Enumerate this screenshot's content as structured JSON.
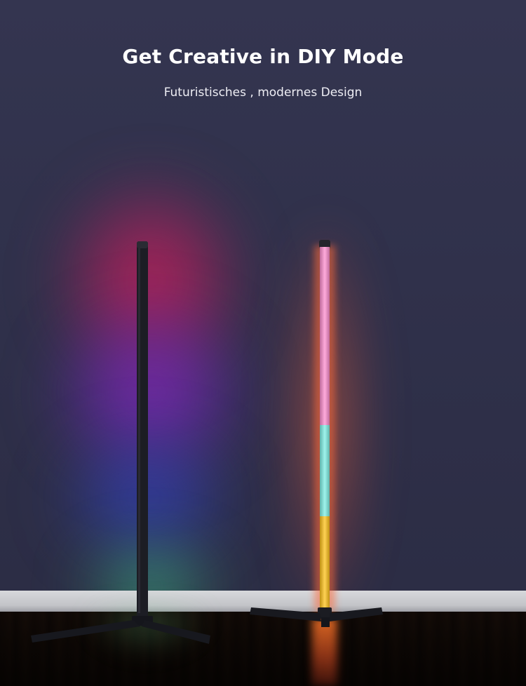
{
  "heading": {
    "title": "Get Creative in DIY Mode",
    "subtitle": "Futuristisches , modernes Design"
  },
  "colors": {
    "wall": "#30314b",
    "glow_red": "#d71e5a",
    "glow_purple": "#8c28c8",
    "glow_blue": "#3246dc",
    "glow_green": "#46e696",
    "tube_pink": "#ff8fd0",
    "tube_cyan": "#7ff0e6",
    "tube_yellow": "#ffc21a",
    "lamp_body": "#1c1d24"
  }
}
